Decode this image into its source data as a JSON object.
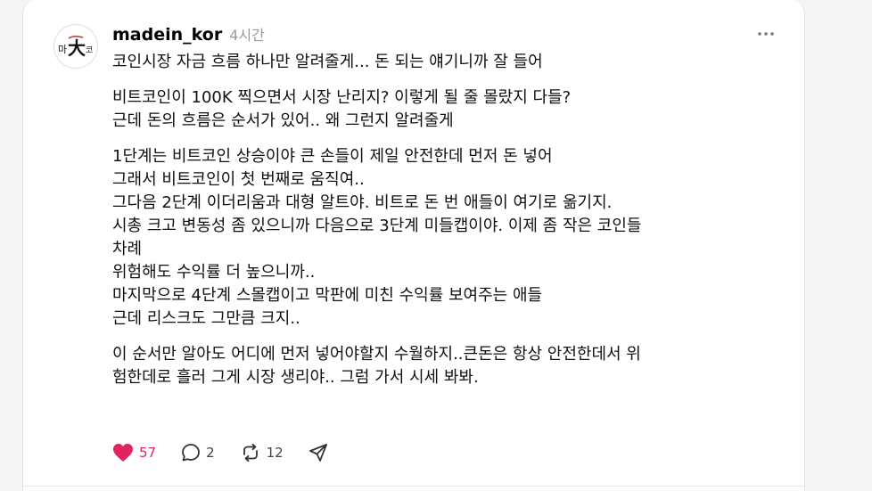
{
  "post": {
    "username": "madein_kor",
    "time": "4시간",
    "avatar_text": "마大코",
    "paragraphs": [
      [
        "코인시장 자금 흐름 하나만 알려줄게... 돈 되는 얘기니까 잘 들어"
      ],
      [
        "비트코인이 100K 찍으면서 시장 난리지? 이렇게 될 줄 몰랐지 다들?",
        "근데 돈의 흐름은 순서가 있어.. 왜 그런지 알려줄게"
      ],
      [
        "1단계는 비트코인 상승이야 큰 손들이 제일 안전한데 먼저 돈 넣어",
        "그래서 비트코인이 첫 번째로 움직여..",
        "그다음 2단계 이더리움과 대형 알트야. 비트로 돈 번 애들이 여기로 옮기지.",
        "시총 크고 변동성 좀 있으니까 다음으로 3단계 미들캡이야. 이제 좀 작은 코인들",
        "차례",
        "위험해도 수익률 더 높으니까..",
        "마지막으로 4단계 스몰캡이고 막판에 미친 수익률 보여주는 애들",
        "근데 리스크도 그만큼 크지.."
      ],
      [
        "이 순서만 알아도 어디에 먼저 넣어야할지 수월하지..큰돈은 항상 안전한데서 위",
        "험한데로 흘러 그게 시장 생리야.. 그럼 가서 시세 봐봐."
      ]
    ]
  },
  "actions": {
    "likes": "57",
    "comments": "2",
    "reposts": "12"
  },
  "colors": {
    "like": "#e0245e",
    "text": "#101010",
    "muted": "#9a9a9a"
  },
  "icons": [
    "more-icon",
    "heart-icon",
    "comment-icon",
    "repost-icon",
    "share-icon"
  ]
}
